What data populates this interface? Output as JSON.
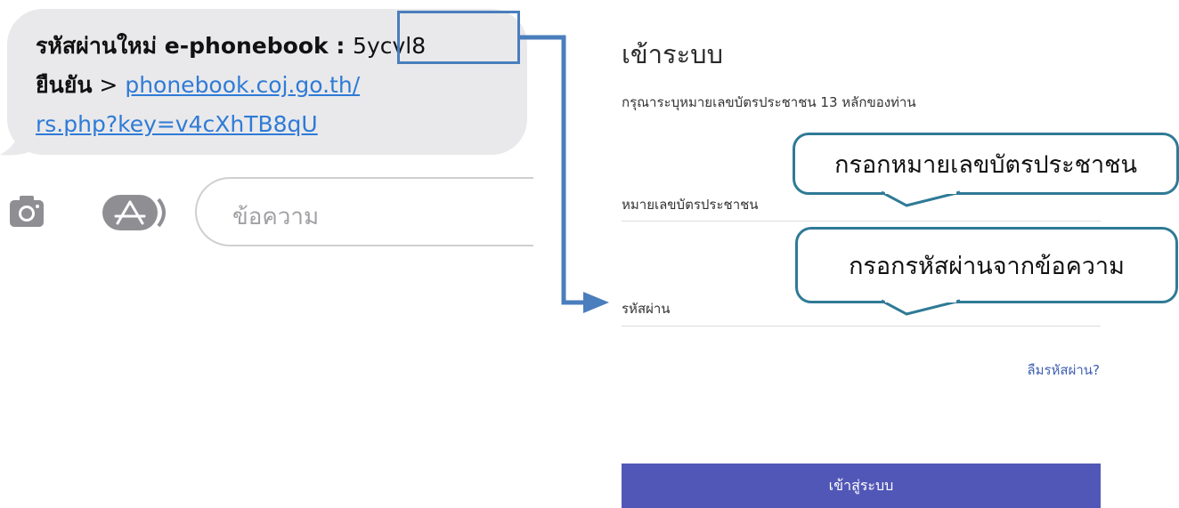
{
  "sms": {
    "line1_prefix": "รหัสผ่านใหม่ e-phonebook : ",
    "code": "5ycvl8",
    "confirm_label": "ยืนยัน",
    "link_separator": " > ",
    "link_line1": "phonebook.coj.go.th/",
    "link_line2": "rs.php?key=v4cXhTB8qU"
  },
  "compose": {
    "placeholder": "ข้อความ",
    "camera_icon": "camera-icon",
    "appstore_icon": "app-store-icon"
  },
  "login": {
    "title": "เข้าระบบ",
    "subtitle": "กรุณาระบุหมายเลขบัตรประชาชน 13 หลักของท่าน",
    "id_label": "หมายเลขบัตรประชาชน",
    "password_label": "รหัสผ่าน",
    "forgot_label": "ลืมรหัสผ่าน?",
    "submit_label": "เข้าสู่ระบบ"
  },
  "callouts": {
    "id_hint": "กรอกหมายเลขบัตรประชาชน",
    "password_hint": "กรอกรหัสผ่านจากข้อความ"
  },
  "colors": {
    "accent": "#5157b6",
    "link": "#2f7bd6",
    "highlight_box": "#4a7ebd",
    "callout_border": "#2f7a96"
  }
}
